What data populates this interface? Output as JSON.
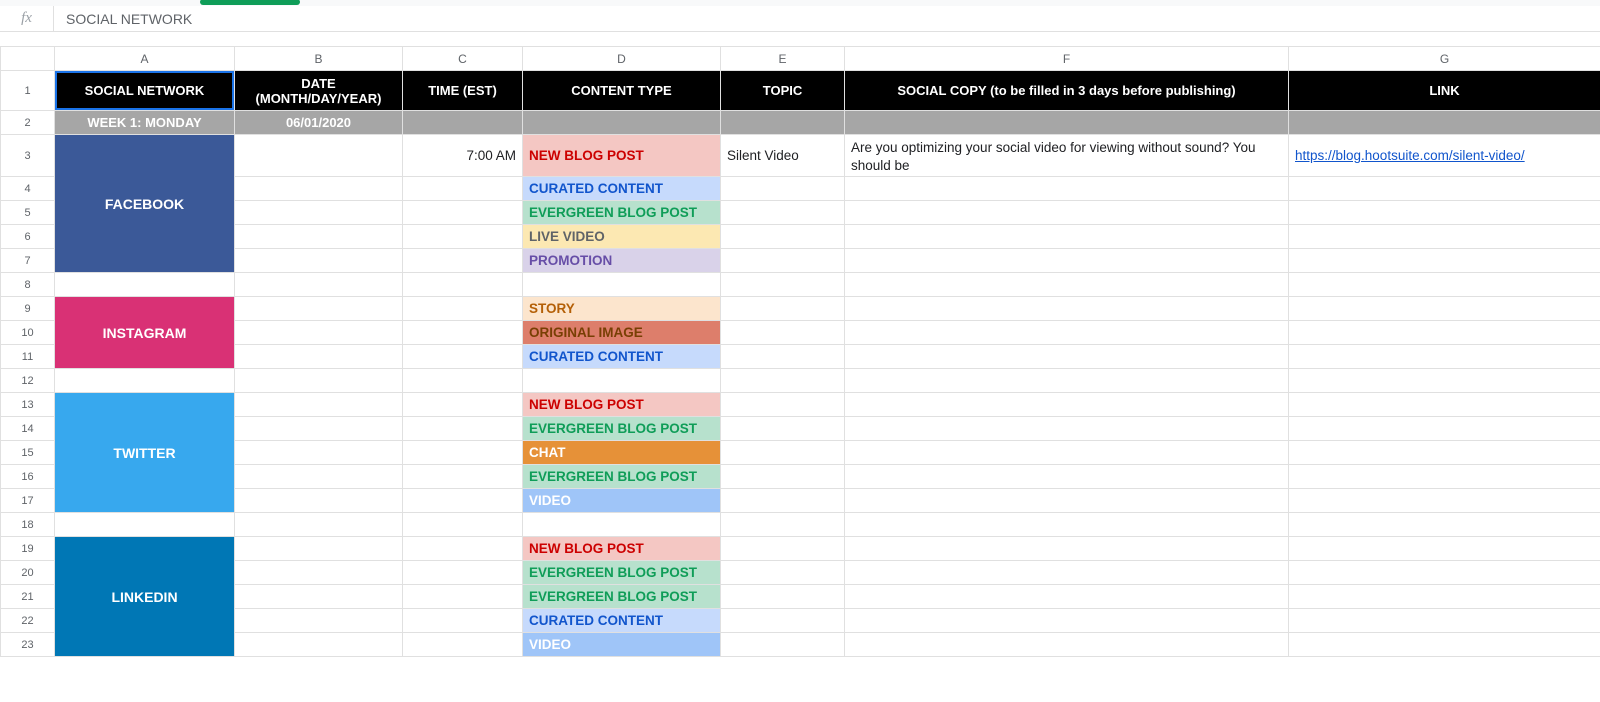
{
  "formula_bar": {
    "fx_label": "fx",
    "value": "SOCIAL NETWORK"
  },
  "columns": [
    "A",
    "B",
    "C",
    "D",
    "E",
    "F",
    "G"
  ],
  "row_numbers": [
    1,
    2,
    3,
    4,
    5,
    6,
    7,
    8,
    9,
    10,
    11,
    12,
    13,
    14,
    15,
    16,
    17,
    18,
    19,
    20,
    21,
    22,
    23
  ],
  "headers": {
    "A": "SOCIAL NETWORK",
    "B": "DATE (MONTH/DAY/YEAR)",
    "C": "TIME (EST)",
    "D": "CONTENT TYPE",
    "E": "TOPIC",
    "F": "SOCIAL COPY (to be filled in 3 days before publishing)",
    "G": "LINK"
  },
  "week_row": {
    "label": "WEEK 1: MONDAY",
    "date": "06/01/2020"
  },
  "networks": {
    "facebook": "FACEBOOK",
    "instagram": "INSTAGRAM",
    "twitter": "TWITTER",
    "linkedin": "LINKEDIN"
  },
  "content_types": {
    "new_blog": "NEW BLOG POST",
    "curated": "CURATED CONTENT",
    "evergreen": "EVERGREEN BLOG POST",
    "live_video": "LIVE VIDEO",
    "promotion": "PROMOTION",
    "story": "STORY",
    "original_image": "ORIGINAL IMAGE",
    "chat": "CHAT",
    "video": "VIDEO"
  },
  "entries": {
    "fb_row3": {
      "time": "7:00 AM",
      "content_type_key": "new_blog",
      "topic": "Silent Video",
      "copy": "Are you optimizing your social video for viewing without sound? You should be",
      "link": "https://blog.hootsuite.com/silent-video/"
    }
  },
  "selection": {
    "cell": "A1"
  }
}
